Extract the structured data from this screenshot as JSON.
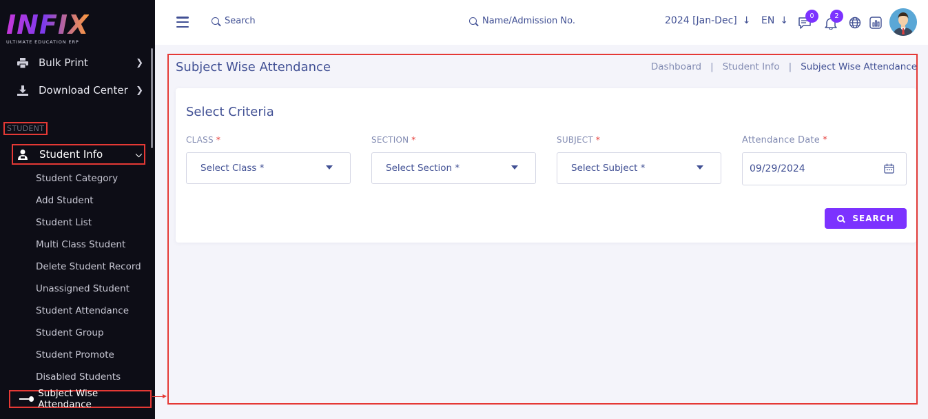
{
  "logo": {
    "title": "INFIX",
    "subtitle": "ULTIMATE EDUCATION ERP"
  },
  "sidebar": {
    "items": [
      {
        "label": "Bulk Print",
        "icon": "printer-icon"
      },
      {
        "label": "Download Center",
        "icon": "download-icon"
      }
    ],
    "section_label": "STUDENT",
    "active_parent": {
      "label": "Student Info",
      "icon": "student-icon"
    },
    "submenu": [
      "Student Category",
      "Add Student",
      "Student List",
      "Multi Class Student",
      "Delete Student Record",
      "Unassigned Student",
      "Student Attendance",
      "Student Group",
      "Student Promote",
      "Disabled Students"
    ],
    "active_child": "Subject Wise Attendance"
  },
  "topbar": {
    "search_placeholder": "Search",
    "student_search_placeholder": "Name/Admission No.",
    "academic_year": "2024 [Jan-Dec]",
    "language": "EN",
    "messages_count": "0",
    "notifications_count": "2"
  },
  "page": {
    "title": "Subject Wise Attendance",
    "breadcrumb": [
      "Dashboard",
      "Student Info",
      "Subject Wise Attendance"
    ]
  },
  "criteria": {
    "title": "Select Criteria",
    "class_label": "CLASS",
    "class_placeholder": "Select Class *",
    "section_label": "SECTION",
    "section_placeholder": "Select Section *",
    "subject_label": "SUBJECT",
    "subject_placeholder": "Select Subject *",
    "date_label": "Attendance Date",
    "date_value": "09/29/2024",
    "required_mark": "*",
    "search_button": "SEARCH"
  },
  "colors": {
    "accent": "#7c32ff",
    "primary_text": "#415094",
    "sidebar_bg": "#0d0d16",
    "highlight_border": "#e53935"
  }
}
